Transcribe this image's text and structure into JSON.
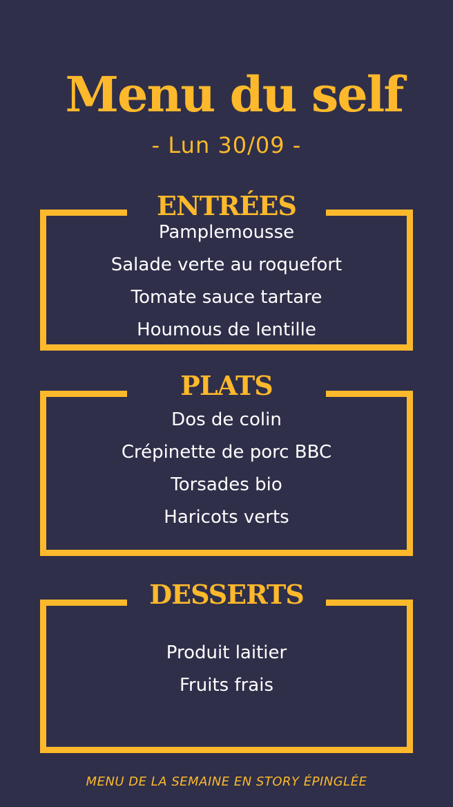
{
  "header": {
    "title": "Menu du self",
    "date": "- Lun 30/09 -"
  },
  "sections": [
    {
      "heading": "ENTRÉES",
      "items": [
        "Pamplemousse",
        "Salade verte au roquefort",
        "Tomate sauce tartare",
        "Houmous de lentille"
      ]
    },
    {
      "heading": "PLATS",
      "items": [
        "Dos de colin",
        "Crépinette de porc BBC",
        "Torsades bio",
        "Haricots verts"
      ]
    },
    {
      "heading": "DESSERTS",
      "items": [
        "Produit laitier",
        "Fruits frais"
      ]
    }
  ],
  "footer": "MENU DE LA SEMAINE EN STORY ÉPINGLÉE",
  "colors": {
    "background": "#2f2f4a",
    "accent": "#fdb92b",
    "text": "#ffffff"
  }
}
